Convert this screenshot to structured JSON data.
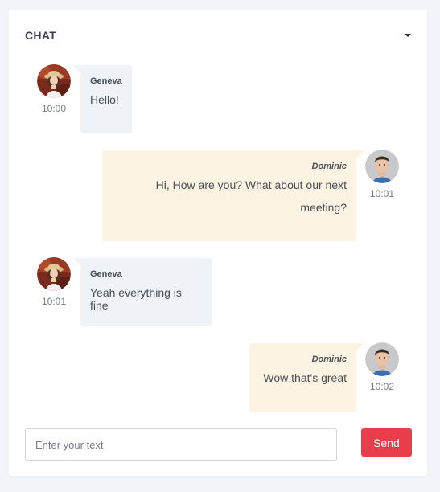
{
  "chat": {
    "title": "CHAT",
    "messages": [
      {
        "side": "left",
        "sender": "Geneva",
        "text": "Hello!",
        "time": "10:00"
      },
      {
        "side": "right",
        "sender": "Dominic",
        "text": "Hi, How are you? What about our next meeting?",
        "time": "10:01"
      },
      {
        "side": "left",
        "sender": "Geneva",
        "text": "Yeah everything is fine",
        "time": "10:01"
      },
      {
        "side": "right",
        "sender": "Dominic",
        "text": "Wow that's great",
        "time": "10:02"
      }
    ],
    "input": {
      "placeholder": "Enter your text",
      "value": ""
    },
    "send_label": "Send"
  },
  "colors": {
    "left_bubble": "#eff2f7",
    "right_bubble": "#fdf3e2",
    "send_button": "#e83e4c",
    "background": "#f3f4f9"
  },
  "icons": {
    "menu": "caret-down-icon",
    "avatar_left": "woman-avatar",
    "avatar_right": "man-avatar"
  }
}
